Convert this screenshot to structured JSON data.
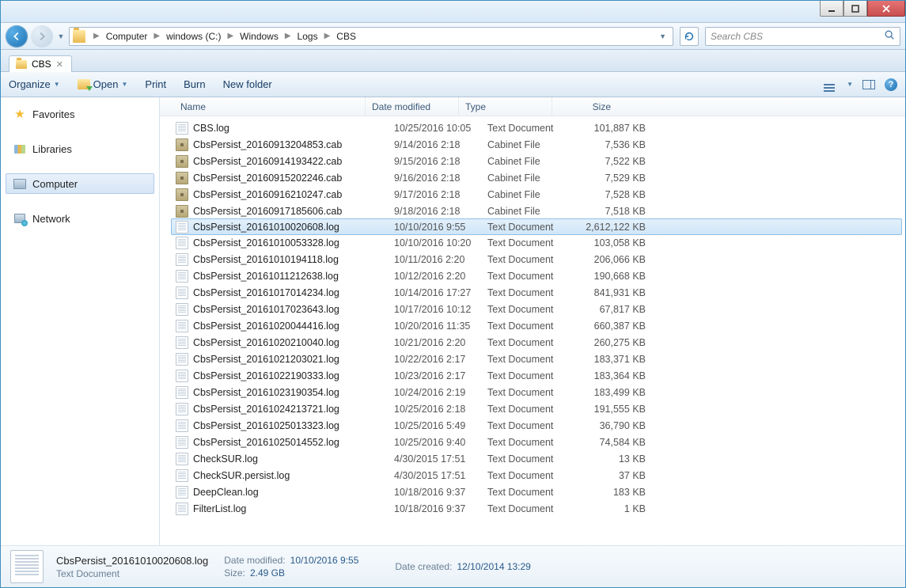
{
  "titlebar": {},
  "nav": {
    "breadcrumb": [
      "Computer",
      "windows (C:)",
      "Windows",
      "Logs",
      "CBS"
    ],
    "search_placeholder": "Search CBS"
  },
  "tab": {
    "label": "CBS"
  },
  "toolbar": {
    "organize": "Organize",
    "open": "Open",
    "print": "Print",
    "burn": "Burn",
    "new_folder": "New folder"
  },
  "sidebar": {
    "favorites": "Favorites",
    "libraries": "Libraries",
    "computer": "Computer",
    "network": "Network"
  },
  "columns": {
    "name": "Name",
    "date": "Date modified",
    "type": "Type",
    "size": "Size"
  },
  "files": [
    {
      "icon": "doc",
      "name": "CBS.log",
      "date": "10/25/2016 10:05",
      "type": "Text Document",
      "size": "101,887 KB",
      "selected": false
    },
    {
      "icon": "cab",
      "name": "CbsPersist_20160913204853.cab",
      "date": "9/14/2016 2:18",
      "type": "Cabinet File",
      "size": "7,536 KB",
      "selected": false
    },
    {
      "icon": "cab",
      "name": "CbsPersist_20160914193422.cab",
      "date": "9/15/2016 2:18",
      "type": "Cabinet File",
      "size": "7,522 KB",
      "selected": false
    },
    {
      "icon": "cab",
      "name": "CbsPersist_20160915202246.cab",
      "date": "9/16/2016 2:18",
      "type": "Cabinet File",
      "size": "7,529 KB",
      "selected": false
    },
    {
      "icon": "cab",
      "name": "CbsPersist_20160916210247.cab",
      "date": "9/17/2016 2:18",
      "type": "Cabinet File",
      "size": "7,528 KB",
      "selected": false
    },
    {
      "icon": "cab",
      "name": "CbsPersist_20160917185606.cab",
      "date": "9/18/2016 2:18",
      "type": "Cabinet File",
      "size": "7,518 KB",
      "selected": false
    },
    {
      "icon": "doc",
      "name": "CbsPersist_20161010020608.log",
      "date": "10/10/2016 9:55",
      "type": "Text Document",
      "size": "2,612,122 KB",
      "selected": true
    },
    {
      "icon": "doc",
      "name": "CbsPersist_20161010053328.log",
      "date": "10/10/2016 10:20",
      "type": "Text Document",
      "size": "103,058 KB",
      "selected": false
    },
    {
      "icon": "doc",
      "name": "CbsPersist_20161010194118.log",
      "date": "10/11/2016 2:20",
      "type": "Text Document",
      "size": "206,066 KB",
      "selected": false
    },
    {
      "icon": "doc",
      "name": "CbsPersist_20161011212638.log",
      "date": "10/12/2016 2:20",
      "type": "Text Document",
      "size": "190,668 KB",
      "selected": false
    },
    {
      "icon": "doc",
      "name": "CbsPersist_20161017014234.log",
      "date": "10/14/2016 17:27",
      "type": "Text Document",
      "size": "841,931 KB",
      "selected": false
    },
    {
      "icon": "doc",
      "name": "CbsPersist_20161017023643.log",
      "date": "10/17/2016 10:12",
      "type": "Text Document",
      "size": "67,817 KB",
      "selected": false
    },
    {
      "icon": "doc",
      "name": "CbsPersist_20161020044416.log",
      "date": "10/20/2016 11:35",
      "type": "Text Document",
      "size": "660,387 KB",
      "selected": false
    },
    {
      "icon": "doc",
      "name": "CbsPersist_20161020210040.log",
      "date": "10/21/2016 2:20",
      "type": "Text Document",
      "size": "260,275 KB",
      "selected": false
    },
    {
      "icon": "doc",
      "name": "CbsPersist_20161021203021.log",
      "date": "10/22/2016 2:17",
      "type": "Text Document",
      "size": "183,371 KB",
      "selected": false
    },
    {
      "icon": "doc",
      "name": "CbsPersist_20161022190333.log",
      "date": "10/23/2016 2:17",
      "type": "Text Document",
      "size": "183,364 KB",
      "selected": false
    },
    {
      "icon": "doc",
      "name": "CbsPersist_20161023190354.log",
      "date": "10/24/2016 2:19",
      "type": "Text Document",
      "size": "183,499 KB",
      "selected": false
    },
    {
      "icon": "doc",
      "name": "CbsPersist_20161024213721.log",
      "date": "10/25/2016 2:18",
      "type": "Text Document",
      "size": "191,555 KB",
      "selected": false
    },
    {
      "icon": "doc",
      "name": "CbsPersist_20161025013323.log",
      "date": "10/25/2016 5:49",
      "type": "Text Document",
      "size": "36,790 KB",
      "selected": false
    },
    {
      "icon": "doc",
      "name": "CbsPersist_20161025014552.log",
      "date": "10/25/2016 9:40",
      "type": "Text Document",
      "size": "74,584 KB",
      "selected": false
    },
    {
      "icon": "doc",
      "name": "CheckSUR.log",
      "date": "4/30/2015 17:51",
      "type": "Text Document",
      "size": "13 KB",
      "selected": false
    },
    {
      "icon": "doc",
      "name": "CheckSUR.persist.log",
      "date": "4/30/2015 17:51",
      "type": "Text Document",
      "size": "37 KB",
      "selected": false
    },
    {
      "icon": "doc",
      "name": "DeepClean.log",
      "date": "10/18/2016 9:37",
      "type": "Text Document",
      "size": "183 KB",
      "selected": false
    },
    {
      "icon": "doc",
      "name": "FilterList.log",
      "date": "10/18/2016 9:37",
      "type": "Text Document",
      "size": "1 KB",
      "selected": false
    }
  ],
  "details": {
    "name": "CbsPersist_20161010020608.log",
    "type": "Text Document",
    "date_modified_label": "Date modified:",
    "date_modified": "10/10/2016 9:55",
    "size_label": "Size:",
    "size": "2.49 GB",
    "date_created_label": "Date created:",
    "date_created": "12/10/2014 13:29"
  }
}
